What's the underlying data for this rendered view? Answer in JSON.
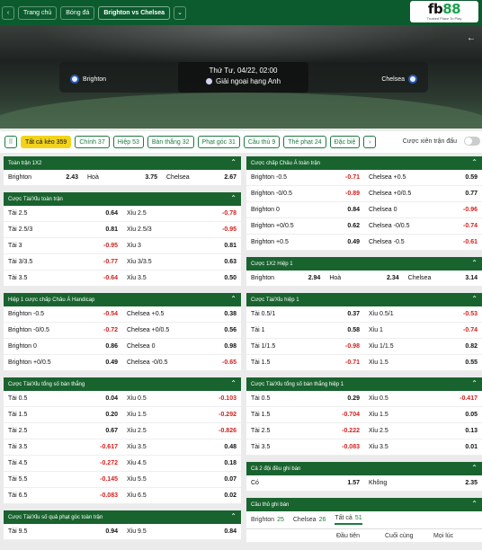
{
  "nav": {
    "home": "Trang chủ",
    "football": "Bóng đá",
    "match": "Brighton vs Chelsea"
  },
  "logo": {
    "text_a": "fb",
    "text_b": "88",
    "sub": "Trusted Place To Play"
  },
  "match": {
    "home": "Brighton",
    "away": "Chelsea",
    "date": "Thứ Tư, 04/22, 02:00",
    "league": "Giải ngoại hạng Anh"
  },
  "tabs": [
    {
      "label": "Tất cả kèo 359",
      "active": true
    },
    {
      "label": "Chính 37"
    },
    {
      "label": "Hiệp 53"
    },
    {
      "label": "Bàn thắng 32"
    },
    {
      "label": "Phạt góc 31"
    },
    {
      "label": "Cầu thủ 9"
    },
    {
      "label": "Thẻ phạt 24"
    },
    {
      "label": "Đặc biệ"
    }
  ],
  "toggle_label": "Cược xiên trận đấu",
  "left": [
    {
      "title": "Toàn trận 1X2",
      "cols": 3,
      "rows": [
        [
          [
            "Brighton",
            "2.43"
          ],
          [
            "Hoà",
            "3.75"
          ],
          [
            "Chelsea",
            "2.67"
          ]
        ]
      ]
    },
    {
      "title": "Cược Tài/Xỉu toàn trận",
      "cols": 2,
      "rows": [
        [
          [
            "Tài 2.5",
            "0.64"
          ],
          [
            "Xỉu 2.5",
            "-0.78"
          ]
        ],
        [
          [
            "Tài 2.5/3",
            "0.81"
          ],
          [
            "Xỉu 2.5/3",
            "-0.95"
          ]
        ],
        [
          [
            "Tài 3",
            "-0.95"
          ],
          [
            "Xỉu 3",
            "0.81"
          ]
        ],
        [
          [
            "Tài 3/3.5",
            "-0.77"
          ],
          [
            "Xỉu 3/3.5",
            "0.63"
          ]
        ],
        [
          [
            "Tài 3.5",
            "-0.64"
          ],
          [
            "Xỉu 3.5",
            "0.50"
          ]
        ]
      ]
    },
    {
      "title": "Hiệp 1 cược chấp Châu Á Handicap",
      "cols": 2,
      "rows": [
        [
          [
            "Brighton -0.5",
            "-0.54"
          ],
          [
            "Chelsea +0.5",
            "0.38"
          ]
        ],
        [
          [
            "Brighton -0/0.5",
            "-0.72"
          ],
          [
            "Chelsea +0/0.5",
            "0.56"
          ]
        ],
        [
          [
            "Brighton 0",
            "0.86"
          ],
          [
            "Chelsea 0",
            "0.98"
          ]
        ],
        [
          [
            "Brighton +0/0.5",
            "0.49"
          ],
          [
            "Chelsea -0/0.5",
            "-0.65"
          ]
        ]
      ]
    },
    {
      "title": "Cược Tài/Xỉu tổng số bàn thắng",
      "cols": 2,
      "rows": [
        [
          [
            "Tài 0.5",
            "0.04"
          ],
          [
            "Xỉu 0.5",
            "-0.103"
          ]
        ],
        [
          [
            "Tài 1.5",
            "0.20"
          ],
          [
            "Xỉu 1.5",
            "-0.292"
          ]
        ],
        [
          [
            "Tài 2.5",
            "0.67"
          ],
          [
            "Xỉu 2.5",
            "-0.826"
          ]
        ],
        [
          [
            "Tài 3.5",
            "-0.617"
          ],
          [
            "Xỉu 3.5",
            "0.48"
          ]
        ],
        [
          [
            "Tài 4.5",
            "-0.272"
          ],
          [
            "Xỉu 4.5",
            "0.18"
          ]
        ],
        [
          [
            "Tài 5.5",
            "-0.145"
          ],
          [
            "Xỉu 5.5",
            "0.07"
          ]
        ],
        [
          [
            "Tài 6.5",
            "-0.083"
          ],
          [
            "Xỉu 6.5",
            "0.02"
          ]
        ]
      ]
    },
    {
      "title": "Cược Tài/Xỉu số quả phạt góc toàn trận",
      "cols": 2,
      "rows": [
        [
          [
            "Tài 9.5",
            "0.94"
          ],
          [
            "Xỉu 9.5",
            "0.84"
          ]
        ]
      ]
    }
  ],
  "right": [
    {
      "title": "Cược chấp Châu Á toàn trận",
      "cols": 2,
      "rows": [
        [
          [
            "Brighton -0.5",
            "-0.71"
          ],
          [
            "Chelsea +0.5",
            "0.59"
          ]
        ],
        [
          [
            "Brighton -0/0.5",
            "-0.89"
          ],
          [
            "Chelsea +0/0.5",
            "0.77"
          ]
        ],
        [
          [
            "Brighton 0",
            "0.84"
          ],
          [
            "Chelsea 0",
            "-0.96"
          ]
        ],
        [
          [
            "Brighton +0/0.5",
            "0.62"
          ],
          [
            "Chelsea -0/0.5",
            "-0.74"
          ]
        ],
        [
          [
            "Brighton +0.5",
            "0.49"
          ],
          [
            "Chelsea -0.5",
            "-0.61"
          ]
        ]
      ]
    },
    {
      "title": "Cược 1X2 Hiệp 1",
      "cols": 3,
      "rows": [
        [
          [
            "Brighton",
            "2.94"
          ],
          [
            "Hoà",
            "2.34"
          ],
          [
            "Chelsea",
            "3.14"
          ]
        ]
      ]
    },
    {
      "title": "Cược Tài/Xỉu hiệp 1",
      "cols": 2,
      "rows": [
        [
          [
            "Tài 0.5/1",
            "0.37"
          ],
          [
            "Xỉu 0.5/1",
            "-0.53"
          ]
        ],
        [
          [
            "Tài 1",
            "0.58"
          ],
          [
            "Xỉu 1",
            "-0.74"
          ]
        ],
        [
          [
            "Tài 1/1.5",
            "-0.98"
          ],
          [
            "Xỉu 1/1.5",
            "0.82"
          ]
        ],
        [
          [
            "Tài 1.5",
            "-0.71"
          ],
          [
            "Xỉu 1.5",
            "0.55"
          ]
        ]
      ]
    },
    {
      "title": "Cược Tài/Xỉu tổng số bàn thắng hiệp 1",
      "cols": 2,
      "rows": [
        [
          [
            "Tài 0.5",
            "0.29"
          ],
          [
            "Xỉu 0.5",
            "-0.417"
          ]
        ],
        [
          [
            "Tài 1.5",
            "-0.704"
          ],
          [
            "Xỉu 1.5",
            "0.05"
          ]
        ],
        [
          [
            "Tài 2.5",
            "-0.222"
          ],
          [
            "Xỉu 2.5",
            "0.13"
          ]
        ],
        [
          [
            "Tài 3.5",
            "-0.083"
          ],
          [
            "Xỉu 3.5",
            "0.01"
          ]
        ]
      ]
    },
    {
      "title": "Cả 2 đội đều ghi bàn",
      "cols": 2,
      "rows": [
        [
          [
            "Có",
            "1.57"
          ],
          [
            "Không",
            "2.35"
          ]
        ]
      ]
    }
  ],
  "scorer": {
    "title": "Cầu thủ ghi bàn",
    "tabs": [
      [
        "Brighton",
        "25"
      ],
      [
        "Chelsea",
        "26"
      ],
      [
        "Tất cả",
        "51"
      ]
    ],
    "headers": [
      "Đầu tiên",
      "Cuối cùng",
      "Mọi lúc"
    ]
  },
  "colors": {
    "green": "#19632f",
    "accent": "#f2d31b",
    "negative": "#d4201c"
  }
}
